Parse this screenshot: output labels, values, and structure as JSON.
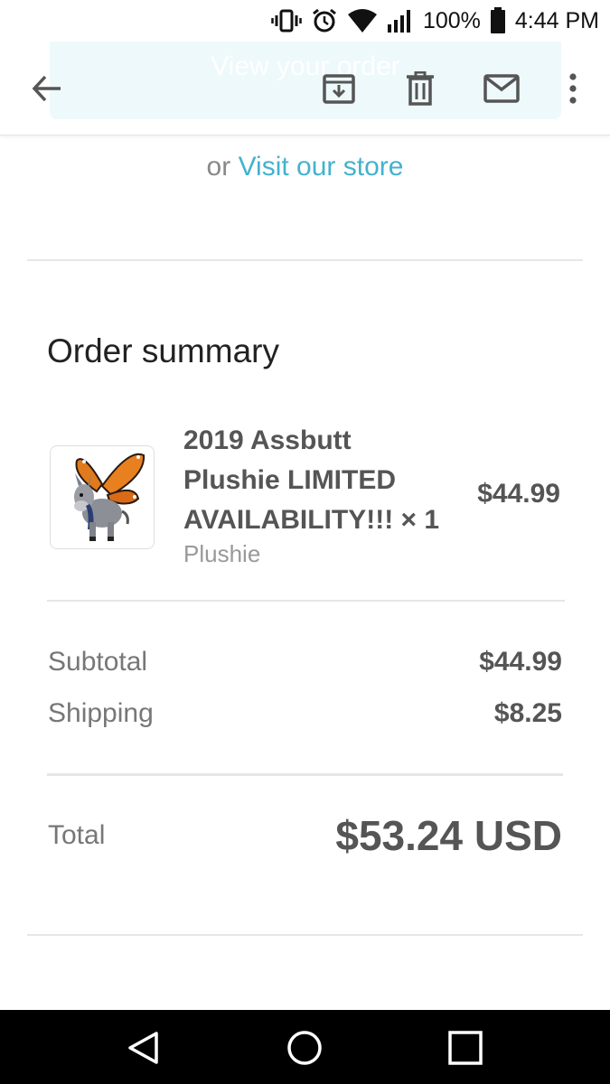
{
  "status_bar": {
    "battery": "100%",
    "time": "4:44 PM",
    "icons": [
      "vibrate-icon",
      "alarm-icon",
      "wifi-icon",
      "signal-icon",
      "battery-icon"
    ]
  },
  "action_bar": {
    "banner_text": "View your order",
    "icons": [
      "back-arrow-icon",
      "archive-icon",
      "delete-icon",
      "mark-unread-icon",
      "more-vert-icon"
    ]
  },
  "email": {
    "visit_prefix": "or",
    "visit_link": "Visit our store",
    "order_summary_title": "Order summary",
    "product": {
      "name": "2019 Assbutt Plushie LIMITED AVAILABILITY!!! × 1",
      "variant": "Plushie",
      "price": "$44.99"
    },
    "subtotal_label": "Subtotal",
    "subtotal_value": "$44.99",
    "shipping_label": "Shipping",
    "shipping_value": "$8.25",
    "total_label": "Total",
    "total_value": "$53.24 USD"
  },
  "nav_bar": {
    "icons": [
      "back-triangle-icon",
      "home-circle-icon",
      "recents-square-icon"
    ]
  },
  "colors": {
    "link": "#44b2cf",
    "text_dark": "#555555",
    "text_muted": "#777777"
  }
}
